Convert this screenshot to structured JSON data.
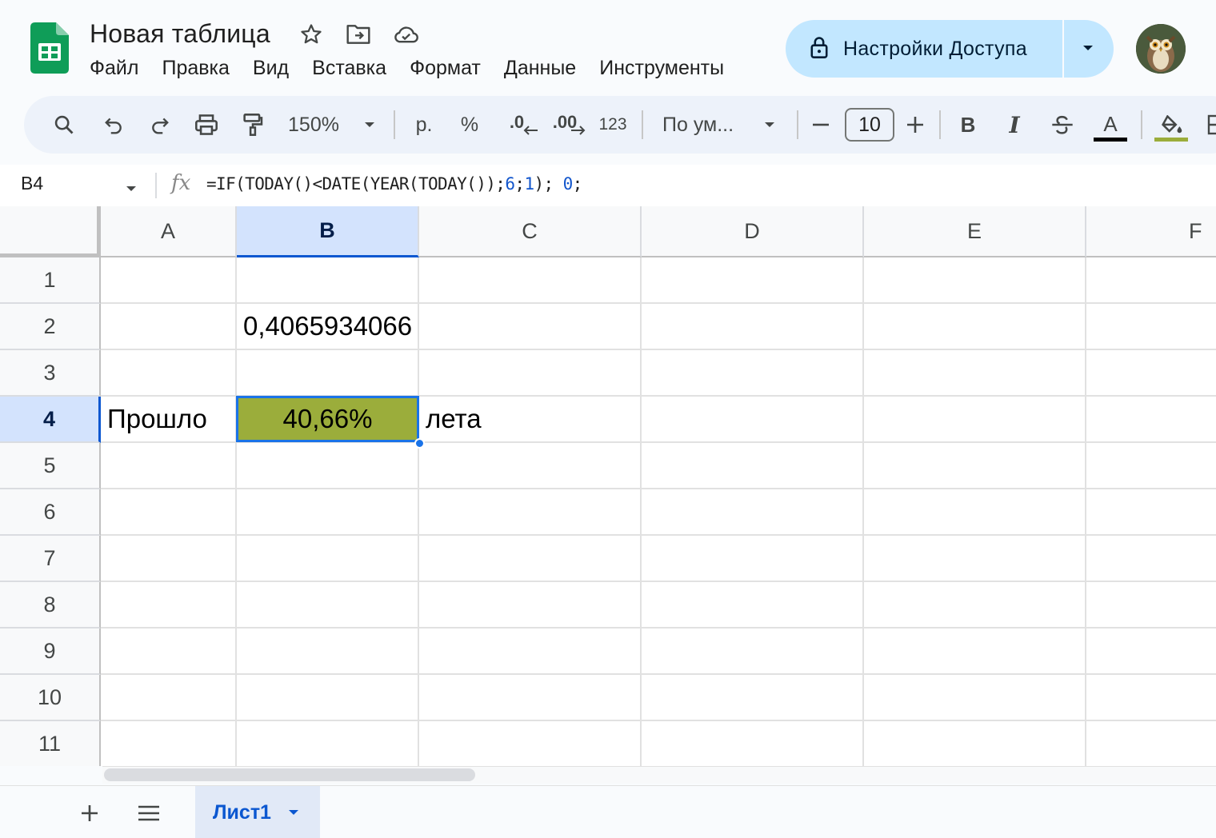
{
  "app": {
    "doc_title": "Новая таблица",
    "menu": [
      "Файл",
      "Правка",
      "Вид",
      "Вставка",
      "Формат",
      "Данные",
      "Инструменты"
    ],
    "share_label": "Настройки Доступа",
    "accent_color": "#c2e7ff"
  },
  "toolbar": {
    "zoom": "150%",
    "currency": "р.",
    "percent": "%",
    "decrease_decimal": ".0",
    "increase_decimal": ".00",
    "number_format": "123",
    "font": "По ум...",
    "font_size": "10",
    "bold": "B",
    "italic": "I",
    "text_color_letter": "A"
  },
  "formula_bar": {
    "cell_ref": "B4",
    "formula_prefix": "=IF(TODAY()<DATE(YEAR(TODAY());",
    "formula_arg1": "6",
    "formula_sep": ";",
    "formula_arg2": "1",
    "formula_mid": "); ",
    "formula_arg3": "0",
    "formula_end": ";"
  },
  "grid": {
    "columns": [
      "A",
      "B",
      "C",
      "D",
      "E",
      "F"
    ],
    "rows": [
      "1",
      "2",
      "3",
      "4",
      "5",
      "6",
      "7",
      "8",
      "9",
      "10",
      "11"
    ],
    "selected_column": "B",
    "selected_row": "4",
    "cells": {
      "B2": "0,4065934066",
      "A4": "Прошло",
      "B4": "40,66%",
      "C4": "лета"
    },
    "b4_fill_color": "#9bad3b"
  },
  "footer": {
    "sheet_name": "Лист1"
  }
}
